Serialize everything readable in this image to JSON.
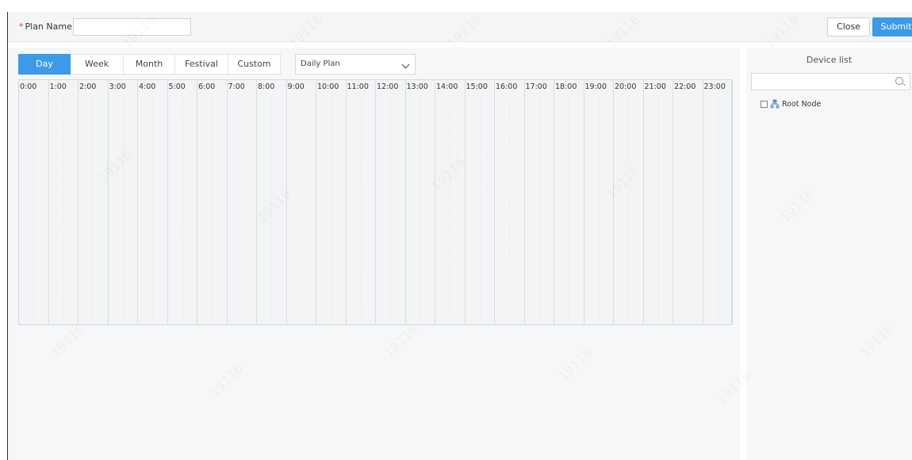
{
  "header": {
    "plan_name_label": "Plan Name:",
    "required_mark": "*",
    "plan_name_value": "",
    "close_label": "Close",
    "submit_label": "Submit"
  },
  "tabs": [
    {
      "label": "Day",
      "active": true
    },
    {
      "label": "Week",
      "active": false
    },
    {
      "label": "Month",
      "active": false
    },
    {
      "label": "Festival",
      "active": false
    },
    {
      "label": "Custom",
      "active": false
    }
  ],
  "plan_select": {
    "selected": "Daily Plan"
  },
  "schedule": {
    "hours": [
      "0:00",
      "1:00",
      "2:00",
      "3:00",
      "4:00",
      "5:00",
      "6:00",
      "7:00",
      "8:00",
      "9:00",
      "10:00",
      "11:00",
      "12:00",
      "13:00",
      "14:00",
      "15:00",
      "16:00",
      "17:00",
      "18:00",
      "19:00",
      "20:00",
      "21:00",
      "22:00",
      "23:00"
    ]
  },
  "device_list": {
    "title": "Device list",
    "search_value": "",
    "nodes": [
      {
        "label": "Root Node",
        "checked": false
      }
    ]
  },
  "colors": {
    "accent": "#3c9ae8",
    "required": "#e23b3b"
  },
  "watermark": "19116"
}
